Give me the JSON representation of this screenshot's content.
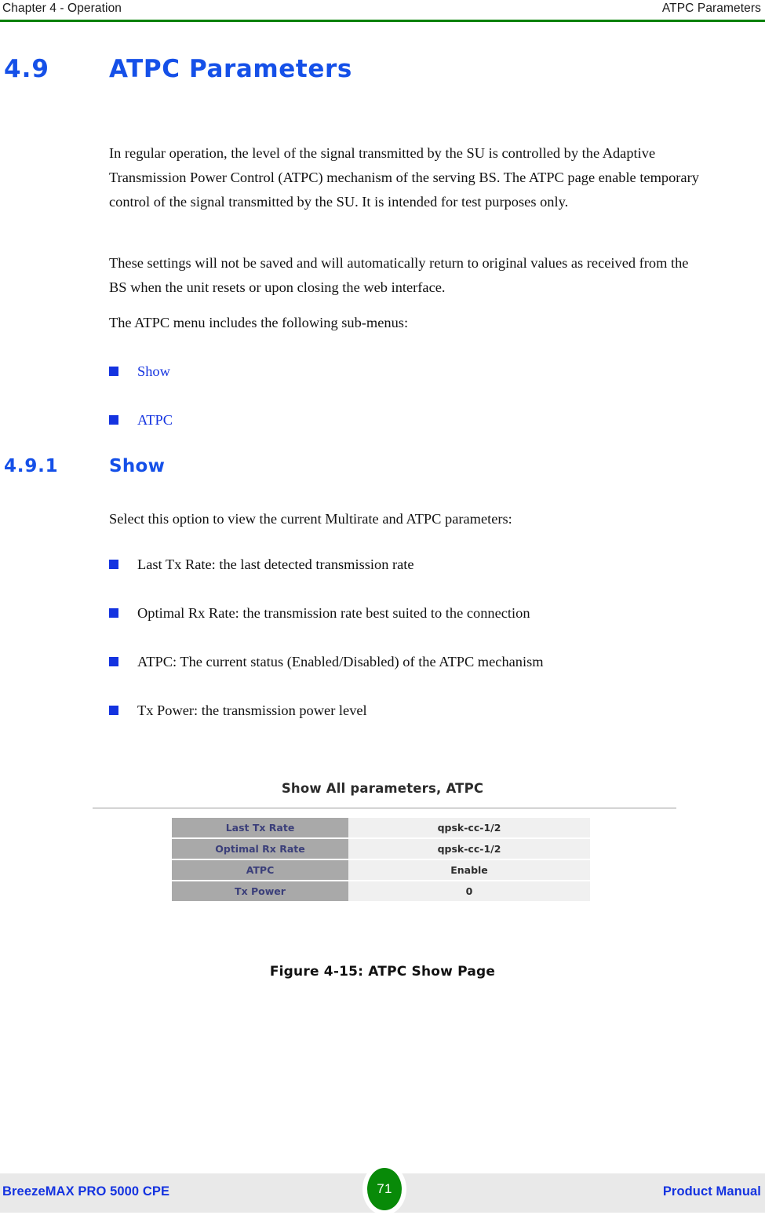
{
  "header": {
    "left": "Chapter 4 - Operation",
    "right": "ATPC Parameters",
    "rule_color": "#008000"
  },
  "heading_main": {
    "number": "4.9",
    "text": "ATPC Parameters",
    "color": "#1550e8"
  },
  "paragraphs": {
    "p1": "In regular operation, the level of the signal transmitted by the SU is controlled by the Adaptive Transmission Power Control (ATPC) mechanism of the serving BS. The ATPC page enable temporary control of the signal transmitted by the SU. It is intended for test purposes only.",
    "p2": "These settings will not be saved and will automatically return to original values as received from the BS when the unit resets or upon closing the web interface.",
    "p3": "The ATPC menu includes the following sub-menus:",
    "p4": "Select this option to view the current Multirate and ATPC parameters:"
  },
  "submenu_links": [
    {
      "label": "Show"
    },
    {
      "label": "ATPC"
    }
  ],
  "heading_sub": {
    "number": "4.9.1",
    "text": "Show",
    "color": "#1550e8"
  },
  "show_bullets": [
    {
      "label": "Last Tx Rate: the last detected transmission rate"
    },
    {
      "label": "Optimal Rx Rate: the transmission rate best suited to the connection"
    },
    {
      "label": "ATPC: The current status (Enabled/Disabled) of the ATPC mechanism"
    },
    {
      "label": "Tx Power: the transmission power level"
    }
  ],
  "figure": {
    "title": "Show All parameters, ATPC",
    "caption": "Figure 4-15: ATPC Show Page",
    "label_bg": "#a9a9a9",
    "label_color": "#3b3f7a",
    "value_bg": "#f0f0f0",
    "rows": [
      {
        "label": "Last Tx Rate",
        "value": "qpsk-cc-1/2"
      },
      {
        "label": "Optimal Rx Rate",
        "value": "qpsk-cc-1/2"
      },
      {
        "label": "ATPC",
        "value": "Enable"
      },
      {
        "label": "Tx Power",
        "value": "0"
      }
    ]
  },
  "footer": {
    "left": "BreezeMAX PRO 5000 CPE",
    "page_number": "71",
    "right": "Product Manual",
    "badge_color": "#088a08",
    "text_color": "#1433e0"
  }
}
